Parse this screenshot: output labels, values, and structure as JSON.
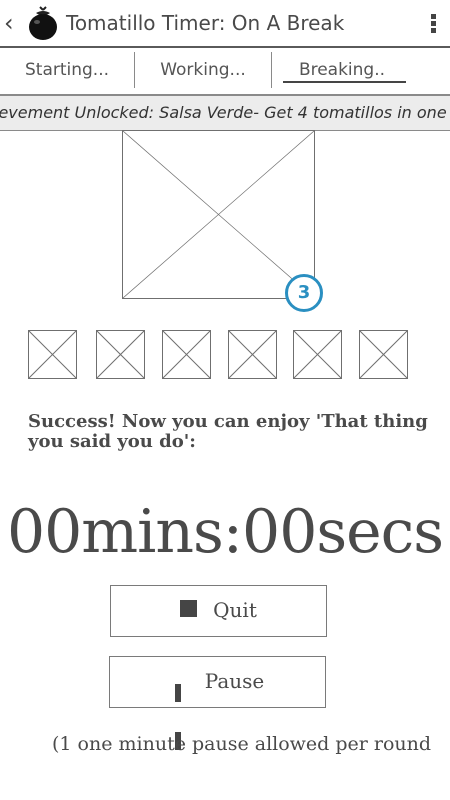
{
  "header": {
    "back_icon": "chevron-left-icon",
    "logo_icon": "tomato-icon",
    "title": "Tomatillo Timer: On A Break",
    "menu_icon": "vertical-dots-icon"
  },
  "tabs": [
    {
      "label": "Starting...",
      "active": false
    },
    {
      "label": "Working...",
      "active": false
    },
    {
      "label": "Breaking..",
      "active": true
    }
  ],
  "banner": {
    "text": "ievement Unlocked: Salsa Verde- Get 4 tomatillos in one"
  },
  "badge": {
    "value": "3",
    "color": "#2a8fc1"
  },
  "message": "Success! Now you can enjoy 'That thing you said you do':",
  "timer": "00mins:00secs",
  "buttons": {
    "quit": {
      "label": "Quit",
      "icon": "stop-icon"
    },
    "pause": {
      "label": "Pause",
      "icon": "pause-icon"
    }
  },
  "footnote": "(1 one minute pause allowed per round"
}
